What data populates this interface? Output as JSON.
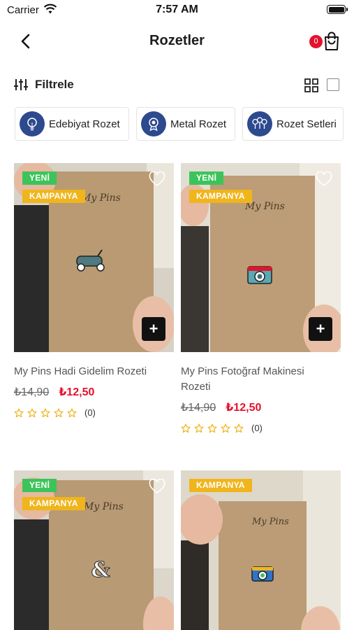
{
  "status_bar": {
    "carrier": "Carrier",
    "time": "7:57 AM"
  },
  "nav": {
    "title": "Rozetler",
    "cart_count": "0"
  },
  "filter": {
    "label": "Filtrele"
  },
  "categories": [
    {
      "label": "Edebiyat Rozet",
      "icon": "lightbulb-icon"
    },
    {
      "label": "Metal Rozet",
      "icon": "medal-icon"
    },
    {
      "label": "Rozet Setleri",
      "icon": "medals-icon"
    }
  ],
  "colors": {
    "accent_red": "#e4122c",
    "badge_new": "#3cc45a",
    "badge_campaign": "#f0b51c",
    "chip_icon_bg": "#2d4a8e",
    "star": "#f0b51c"
  },
  "products": [
    {
      "badges": [
        "YENİ",
        "KAMPANYA"
      ],
      "name": "My Pins Hadi Gidelim Rozeti",
      "old_price": "₺14,90",
      "new_price": "₺12,50",
      "rating_count": "(0)",
      "rating": 0,
      "card_text": "My Pins",
      "pin": "scooter"
    },
    {
      "badges": [
        "YENİ",
        "KAMPANYA"
      ],
      "name": "My Pins Fotoğraf Makinesi Rozeti",
      "old_price": "₺14,90",
      "new_price": "₺12,50",
      "rating_count": "(0)",
      "rating": 0,
      "card_text": "My Pins",
      "pin": "camera"
    },
    {
      "badges": [
        "YENİ",
        "KAMPANYA"
      ],
      "name": "",
      "card_text": "My Pins",
      "pin": "ampersand"
    },
    {
      "badges": [
        "KAMPANYA"
      ],
      "name": "",
      "card_text": "My Pins",
      "pin": "camera-color"
    }
  ]
}
